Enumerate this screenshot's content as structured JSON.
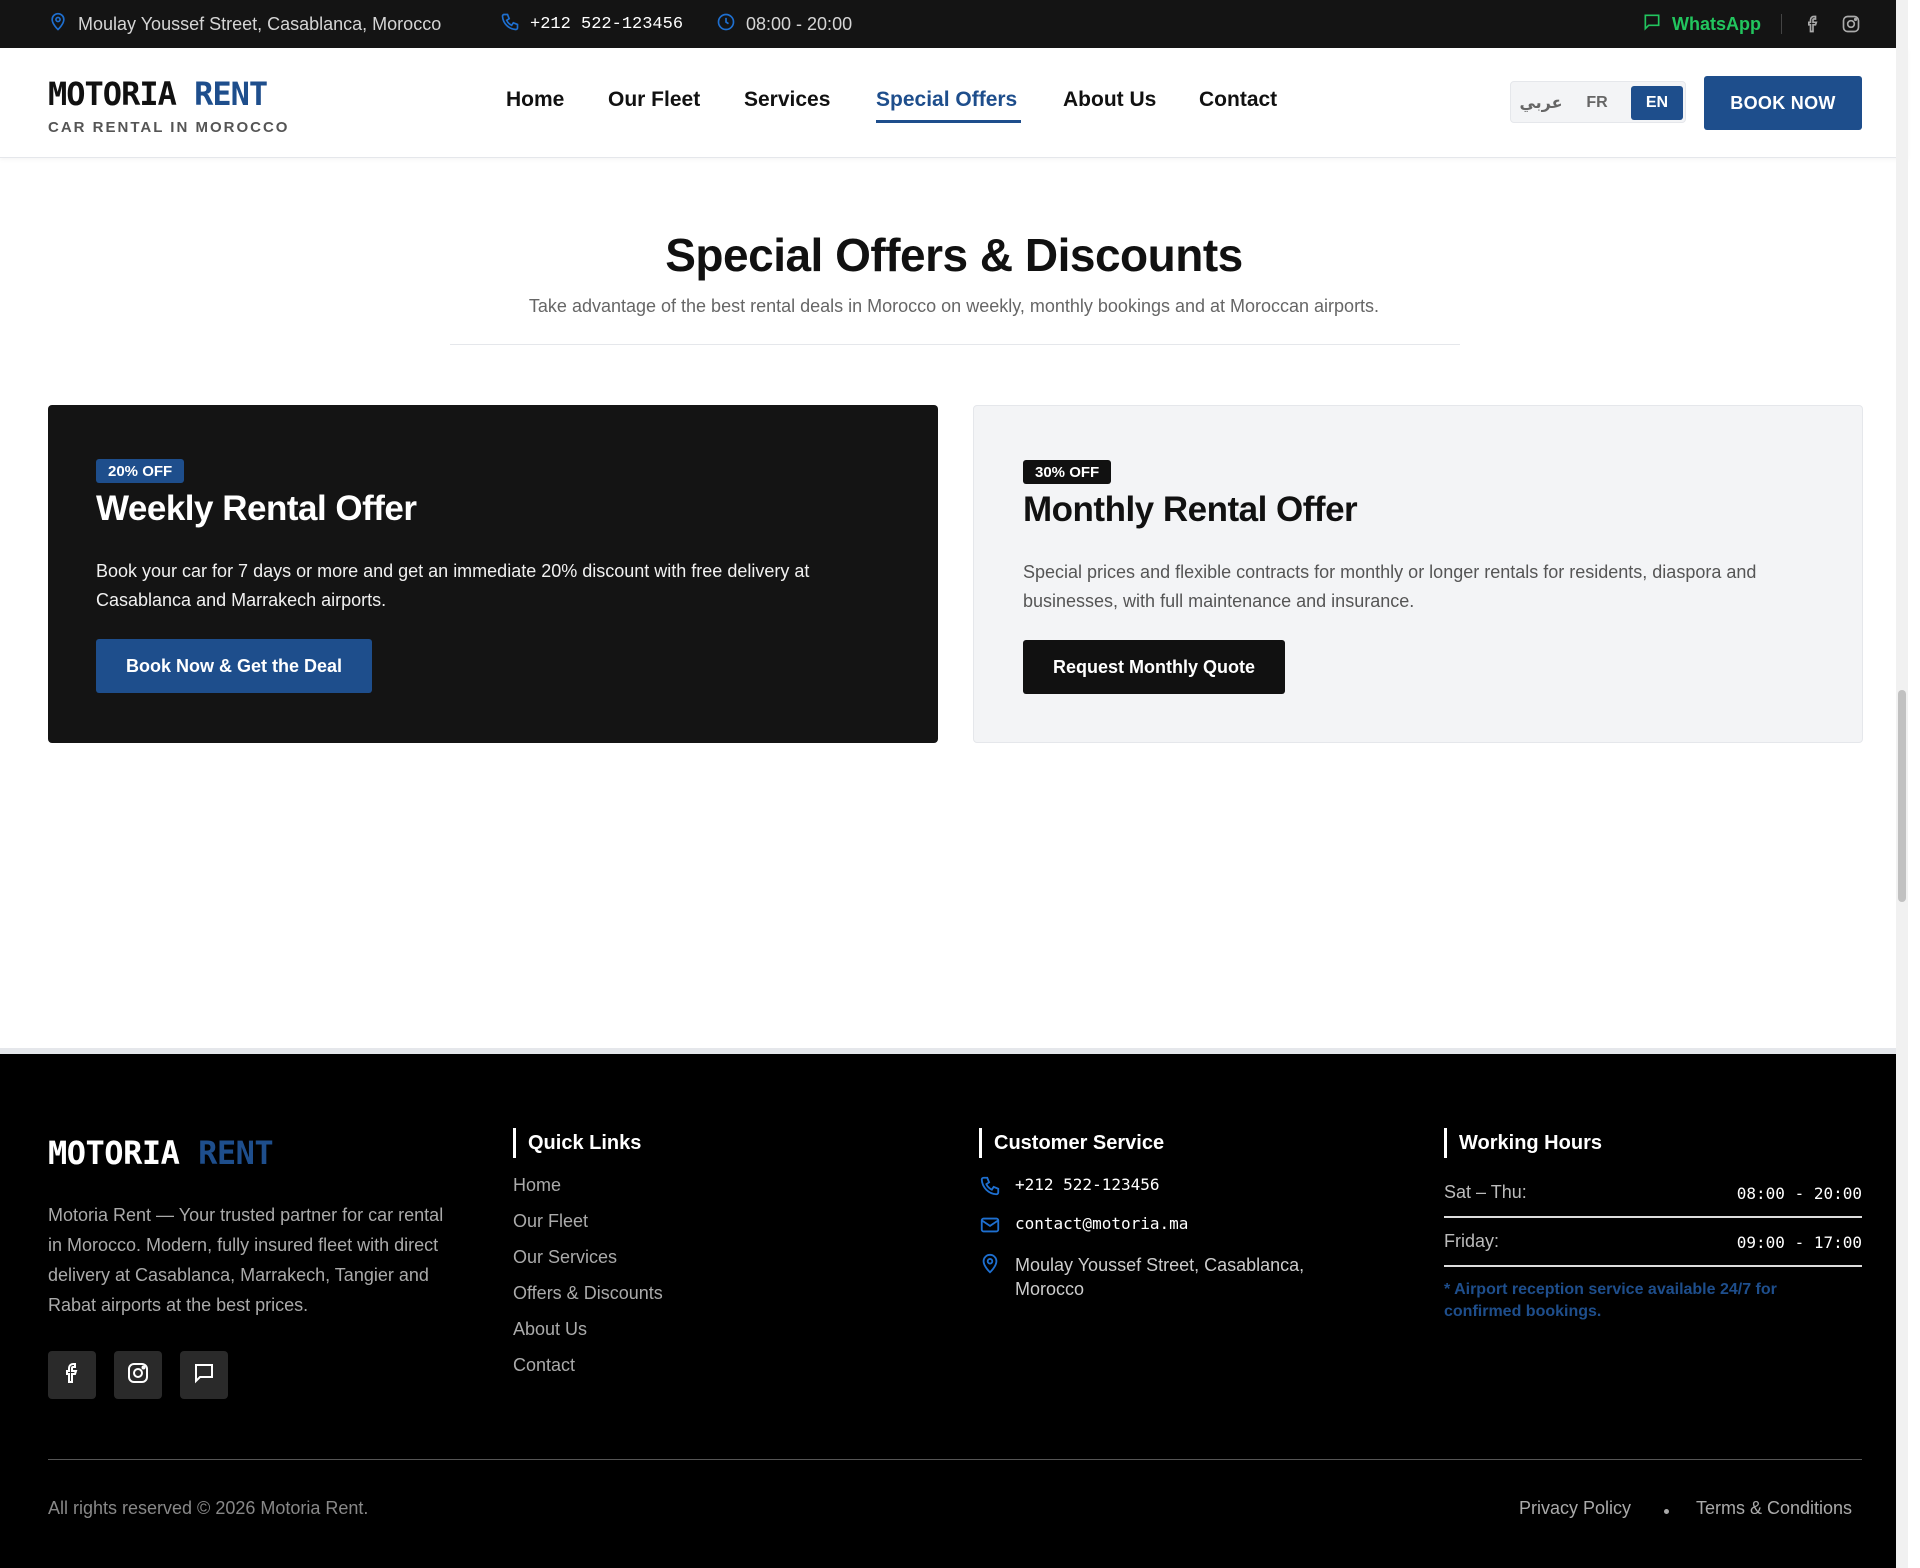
{
  "topbar": {
    "address": "Moulay Youssef Street, Casablanca, Morocco",
    "phone": "+212 522-123456",
    "hours": "08:00 - 20:00",
    "whatsapp": "WhatsApp"
  },
  "header": {
    "logo_part1": "MOTORIA",
    "logo_part2": "RENT",
    "tagline": "CAR RENTAL IN MOROCCO",
    "nav": {
      "home": "Home",
      "fleet": "Our Fleet",
      "services": "Services",
      "offers": "Special Offers",
      "about": "About Us",
      "contact": "Contact"
    },
    "lang": {
      "ar": "عربي",
      "fr": "FR",
      "en": "EN",
      "active": "EN"
    },
    "book_now": "BOOK NOW"
  },
  "section": {
    "title": "Special Offers & Discounts",
    "subtitle": "Take advantage of the best rental deals in Morocco on weekly, monthly bookings and at Moroccan airports."
  },
  "offers": [
    {
      "badge": "20% OFF",
      "title": "Weekly Rental Offer",
      "text": "Book your car for 7 days or more and get an immediate 20% discount with free delivery at Casablanca and Marrakech airports.",
      "button": "Book Now & Get the Deal"
    },
    {
      "badge": "30% OFF",
      "title": "Monthly Rental Offer",
      "text": "Special prices and flexible contracts for monthly or longer rentals for residents, diaspora and businesses, with full maintenance and insurance.",
      "button": "Request Monthly Quote"
    }
  ],
  "footer": {
    "logo_part1": "MOTORIA",
    "logo_part2": "RENT",
    "description": "Motoria Rent — Your trusted partner for car rental in Morocco. Modern, fully insured fleet with direct delivery at Casablanca, Marrakech, Tangier and Rabat airports at the best prices.",
    "quick_links_title": "Quick Links",
    "quick_links": [
      "Home",
      "Our Fleet",
      "Our Services",
      "Offers & Discounts",
      "About Us",
      "Contact"
    ],
    "customer_service_title": "Customer Service",
    "cs_phone": "+212 522-123456",
    "cs_email": "contact@motoria.ma",
    "cs_address": "Moulay Youssef Street, Casablanca, Morocco",
    "working_hours_title": "Working Hours",
    "hours": [
      {
        "day": "Sat – Thu:",
        "time": "08:00 - 20:00"
      },
      {
        "day": "Friday:",
        "time": "09:00 - 17:00"
      }
    ],
    "hours_note": "* Airport reception service available 24/7 for confirmed bookings.",
    "copyright": "All rights reserved © 2026 Motoria Rent.",
    "privacy": "Privacy Policy",
    "terms": "Terms & Conditions"
  },
  "colors": {
    "brand_blue": "#1e4e8c",
    "whatsapp_green": "#22c55e",
    "dark": "#141414"
  }
}
